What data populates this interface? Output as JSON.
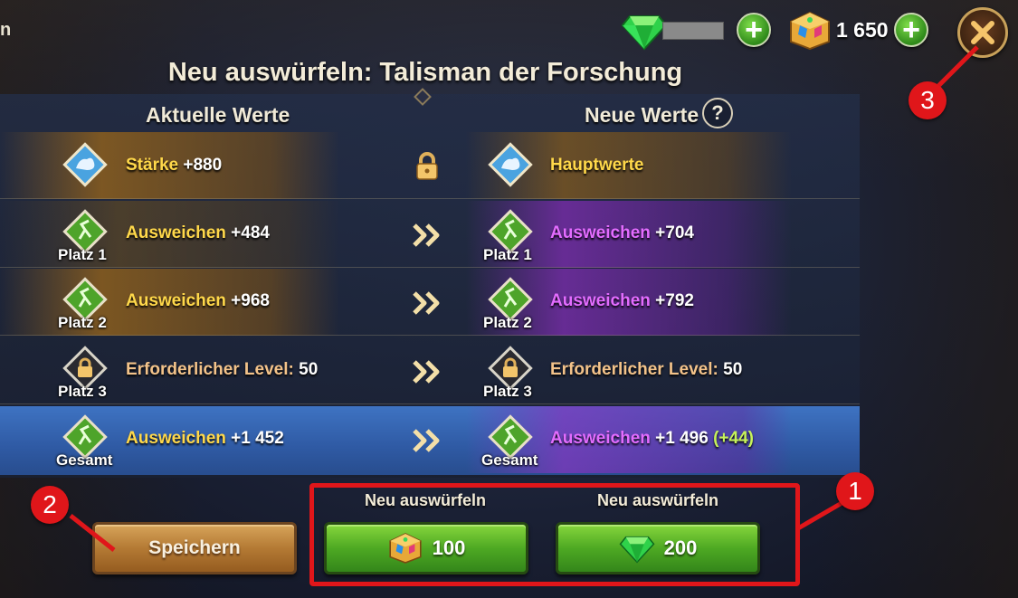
{
  "edge_letter": "n",
  "currency": {
    "emerald_icon": "emerald-gem-icon",
    "gold_icon": "gold-cube-icon",
    "gold_value": "1 650",
    "plus_icon": "plus-icon"
  },
  "close_icon": "close-icon",
  "title": "Neu auswürfeln: Talisman der Forschung",
  "headers": {
    "current": "Aktuelle Werte",
    "new": "Neue Werte",
    "help": "?"
  },
  "rows": [
    {
      "left": {
        "label": "Stärke",
        "value": " +880",
        "slot": ""
      },
      "right": {
        "label": "Hauptwerte",
        "value": "",
        "slot": "",
        "bonus": ""
      },
      "middle_icon": "lock-icon"
    },
    {
      "left": {
        "label": "Ausweichen",
        "value": " +484",
        "slot": "Platz 1"
      },
      "right": {
        "label": "Ausweichen",
        "value": " +704",
        "slot": "Platz 1",
        "bonus": ""
      },
      "middle_icon": "double-chevron-right-icon"
    },
    {
      "left": {
        "label": "Ausweichen",
        "value": " +968",
        "slot": "Platz 2"
      },
      "right": {
        "label": "Ausweichen",
        "value": " +792",
        "slot": "Platz 2",
        "bonus": ""
      },
      "middle_icon": "double-chevron-right-icon"
    },
    {
      "left": {
        "label": "Erforderlicher Level:",
        "value": " 50",
        "slot": "Platz 3"
      },
      "right": {
        "label": "Erforderlicher Level:",
        "value": " 50",
        "slot": "Platz 3",
        "bonus": ""
      },
      "middle_icon": "double-chevron-right-icon"
    },
    {
      "left": {
        "label": "Ausweichen",
        "value": " +1 452",
        "slot": "Gesamt"
      },
      "right": {
        "label": "Ausweichen",
        "value": " +1 496",
        "slot": "Gesamt",
        "bonus": " (+44)"
      },
      "middle_icon": "double-chevron-right-icon"
    }
  ],
  "actions": {
    "save": "Speichern",
    "reroll_gold_label": "Neu auswürfeln",
    "reroll_gold_cost": "100",
    "reroll_emerald_label": "Neu auswürfeln",
    "reroll_emerald_cost": "200"
  },
  "markers": [
    "1",
    "2",
    "3"
  ],
  "colors": {
    "highlight_red": "#e0161a",
    "stat_yellow": "#ffd84a",
    "stat_purple": "#e36cff",
    "bonus_green": "#c6f25a"
  }
}
